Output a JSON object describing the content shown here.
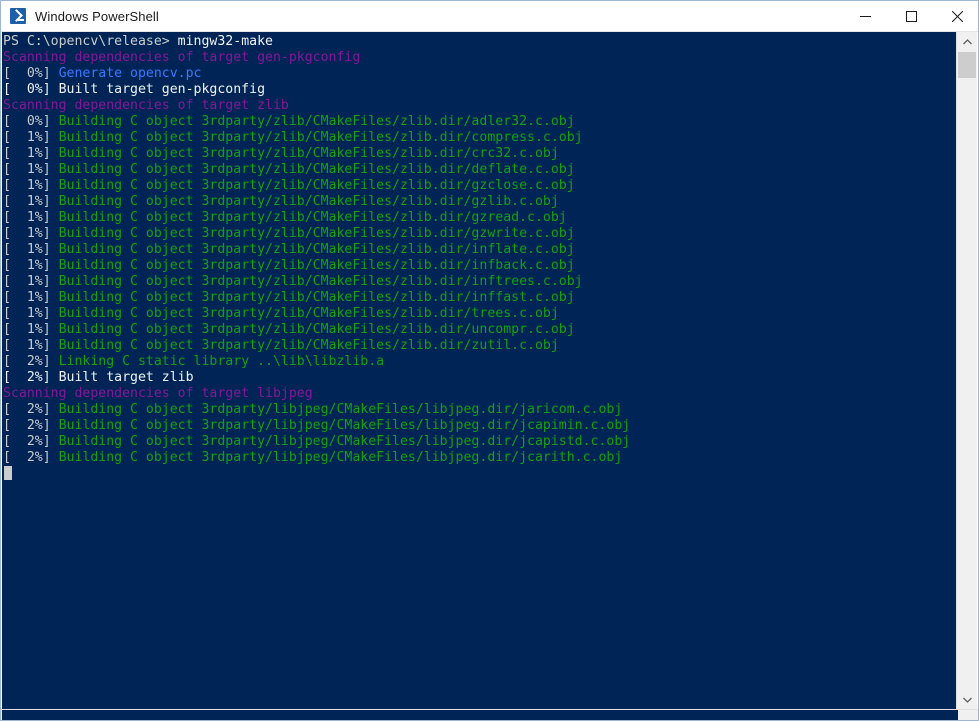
{
  "window": {
    "title": "Windows PowerShell",
    "icon": "powershell-icon",
    "controls": {
      "minimize": "minimize-button",
      "maximize": "maximize-button",
      "close": "close-button"
    }
  },
  "theme": {
    "background": "#012456",
    "foreground": "#cccccc",
    "green": "#13a10e",
    "magenta": "#881798",
    "blue": "#3b78ff",
    "bright_white": "#f2f2f2",
    "titlebar_background": "#ffffff",
    "titlebar_text": "#1a1a1a"
  },
  "prompt": {
    "text": "PS C:\\opencv\\release> ",
    "command": "mingw32-make"
  },
  "terminal": {
    "lines": [
      {
        "segments": [
          {
            "text": "PS C:\\opencv\\release> ",
            "color": "white"
          },
          {
            "text": "mingw32-make",
            "color": "bright"
          }
        ]
      },
      {
        "segments": [
          {
            "text": "Scanning dependencies of target gen-pkgconfig",
            "color": "magenta"
          }
        ]
      },
      {
        "segments": [
          {
            "text": "[  0%] ",
            "color": "white"
          },
          {
            "text": "Generate opencv.pc",
            "color": "blue"
          }
        ]
      },
      {
        "segments": [
          {
            "text": "[  0%] Built target gen-pkgconfig",
            "color": "bright"
          }
        ]
      },
      {
        "segments": [
          {
            "text": "Scanning dependencies of target zlib",
            "color": "magenta"
          }
        ]
      },
      {
        "segments": [
          {
            "text": "[  0%] ",
            "color": "white"
          },
          {
            "text": "Building C object 3rdparty/zlib/CMakeFiles/zlib.dir/adler32.c.obj",
            "color": "green"
          }
        ]
      },
      {
        "segments": [
          {
            "text": "[  1%] ",
            "color": "white"
          },
          {
            "text": "Building C object 3rdparty/zlib/CMakeFiles/zlib.dir/compress.c.obj",
            "color": "green"
          }
        ]
      },
      {
        "segments": [
          {
            "text": "[  1%] ",
            "color": "white"
          },
          {
            "text": "Building C object 3rdparty/zlib/CMakeFiles/zlib.dir/crc32.c.obj",
            "color": "green"
          }
        ]
      },
      {
        "segments": [
          {
            "text": "[  1%] ",
            "color": "white"
          },
          {
            "text": "Building C object 3rdparty/zlib/CMakeFiles/zlib.dir/deflate.c.obj",
            "color": "green"
          }
        ]
      },
      {
        "segments": [
          {
            "text": "[  1%] ",
            "color": "white"
          },
          {
            "text": "Building C object 3rdparty/zlib/CMakeFiles/zlib.dir/gzclose.c.obj",
            "color": "green"
          }
        ]
      },
      {
        "segments": [
          {
            "text": "[  1%] ",
            "color": "white"
          },
          {
            "text": "Building C object 3rdparty/zlib/CMakeFiles/zlib.dir/gzlib.c.obj",
            "color": "green"
          }
        ]
      },
      {
        "segments": [
          {
            "text": "[  1%] ",
            "color": "white"
          },
          {
            "text": "Building C object 3rdparty/zlib/CMakeFiles/zlib.dir/gzread.c.obj",
            "color": "green"
          }
        ]
      },
      {
        "segments": [
          {
            "text": "[  1%] ",
            "color": "white"
          },
          {
            "text": "Building C object 3rdparty/zlib/CMakeFiles/zlib.dir/gzwrite.c.obj",
            "color": "green"
          }
        ]
      },
      {
        "segments": [
          {
            "text": "[  1%] ",
            "color": "white"
          },
          {
            "text": "Building C object 3rdparty/zlib/CMakeFiles/zlib.dir/inflate.c.obj",
            "color": "green"
          }
        ]
      },
      {
        "segments": [
          {
            "text": "[  1%] ",
            "color": "white"
          },
          {
            "text": "Building C object 3rdparty/zlib/CMakeFiles/zlib.dir/infback.c.obj",
            "color": "green"
          }
        ]
      },
      {
        "segments": [
          {
            "text": "[  1%] ",
            "color": "white"
          },
          {
            "text": "Building C object 3rdparty/zlib/CMakeFiles/zlib.dir/inftrees.c.obj",
            "color": "green"
          }
        ]
      },
      {
        "segments": [
          {
            "text": "[  1%] ",
            "color": "white"
          },
          {
            "text": "Building C object 3rdparty/zlib/CMakeFiles/zlib.dir/inffast.c.obj",
            "color": "green"
          }
        ]
      },
      {
        "segments": [
          {
            "text": "[  1%] ",
            "color": "white"
          },
          {
            "text": "Building C object 3rdparty/zlib/CMakeFiles/zlib.dir/trees.c.obj",
            "color": "green"
          }
        ]
      },
      {
        "segments": [
          {
            "text": "[  1%] ",
            "color": "white"
          },
          {
            "text": "Building C object 3rdparty/zlib/CMakeFiles/zlib.dir/uncompr.c.obj",
            "color": "green"
          }
        ]
      },
      {
        "segments": [
          {
            "text": "[  1%] ",
            "color": "white"
          },
          {
            "text": "Building C object 3rdparty/zlib/CMakeFiles/zlib.dir/zutil.c.obj",
            "color": "green"
          }
        ]
      },
      {
        "segments": [
          {
            "text": "[  2%] ",
            "color": "white"
          },
          {
            "text": "Linking C static library ..\\lib\\libzlib.a",
            "color": "green"
          }
        ]
      },
      {
        "segments": [
          {
            "text": "[  2%] Built target zlib",
            "color": "bright"
          }
        ]
      },
      {
        "segments": [
          {
            "text": "Scanning dependencies of target libjpeg",
            "color": "magenta"
          }
        ]
      },
      {
        "segments": [
          {
            "text": "[  2%] ",
            "color": "white"
          },
          {
            "text": "Building C object 3rdparty/libjpeg/CMakeFiles/libjpeg.dir/jaricom.c.obj",
            "color": "green"
          }
        ]
      },
      {
        "segments": [
          {
            "text": "[  2%] ",
            "color": "white"
          },
          {
            "text": "Building C object 3rdparty/libjpeg/CMakeFiles/libjpeg.dir/jcapimin.c.obj",
            "color": "green"
          }
        ]
      },
      {
        "segments": [
          {
            "text": "[  2%] ",
            "color": "white"
          },
          {
            "text": "Building C object 3rdparty/libjpeg/CMakeFiles/libjpeg.dir/jcapistd.c.obj",
            "color": "green"
          }
        ]
      },
      {
        "segments": [
          {
            "text": "[  2%] ",
            "color": "white"
          },
          {
            "text": "Building C object 3rdparty/libjpeg/CMakeFiles/libjpeg.dir/jcarith.c.obj",
            "color": "green"
          }
        ]
      }
    ],
    "cursor": {
      "visible": true,
      "line_index": 27,
      "column": 0
    }
  },
  "scrollbar": {
    "up_arrow": "scroll-up-arrow",
    "down_arrow": "scroll-down-arrow",
    "thumb_position_percent": 0,
    "thumb_size_percent": 4
  }
}
